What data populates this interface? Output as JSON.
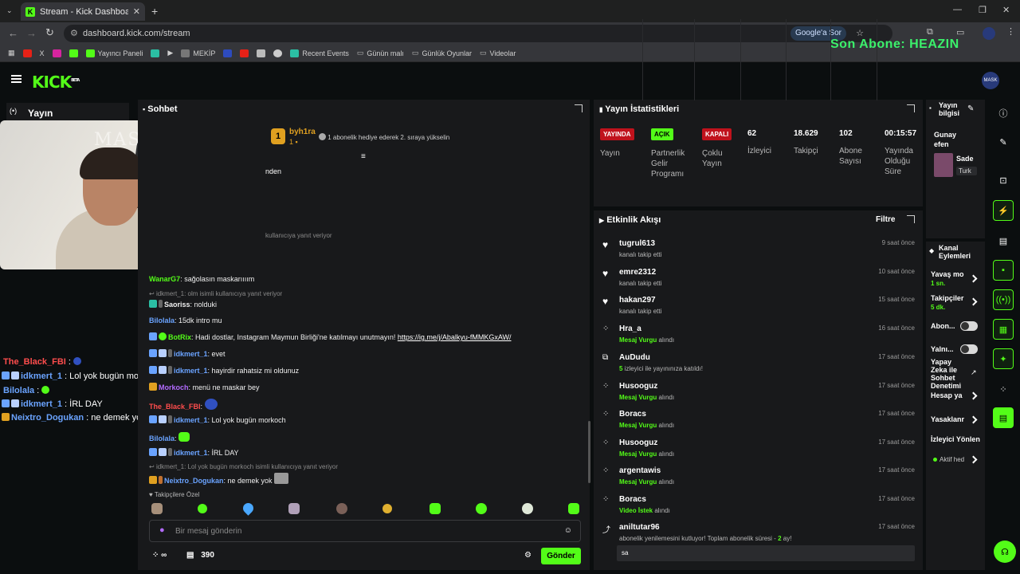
{
  "browser": {
    "tab_title": "Stream - Kick Dashboard",
    "url": "dashboard.kick.com/stream",
    "google_sor": "Google'a Sor",
    "bookmarks": [
      "Yayıncı Paneli",
      "MEKİP",
      "Recent Events",
      "Günün malı",
      "Günlük Oyunlar",
      "Videolar"
    ]
  },
  "stream_overlay": {
    "last_sub": "Son Abone: HEAZIN",
    "cam_watermark": "MASKAR"
  },
  "header": {
    "logo": "KICK",
    "logo_sup": "BETA"
  },
  "sidebar": {
    "stream_label": "Yayın"
  },
  "overlay_chat": [
    {
      "user": "The_Black_FBI",
      "text": " :",
      "color": "#ff4d4d"
    },
    {
      "user": "idkmert_1",
      "text": " : Lol yok bugün morkoch",
      "color": "#6aa3ff"
    },
    {
      "user": "Bilolala",
      "text": " :",
      "color": "#6aa3ff"
    },
    {
      "user": "idkmert_1",
      "text": " : İRL DAY",
      "color": "#6aa3ff"
    },
    {
      "user": "Neixtro_Dogukan",
      "text": " : ne demek yok",
      "color": "#6aa3ff"
    }
  ],
  "chat": {
    "title": "Sohbet",
    "pinned_user": "byh1ra",
    "pinned_rank": "1",
    "gift_promo": "1 abonelik hediye ederek 2. sıraya yükselin",
    "partial_line": "nden",
    "partial_reply": "kullanıcıya yanıt veriyor",
    "messages": [
      {
        "type": "msg",
        "user": "WanarG7",
        "color": "#53fc18",
        "text": ": sağolasın maskarıııım"
      },
      {
        "type": "reply",
        "text": "idkmert_1: olm isimli kullanıcıya yanıt veriyor"
      },
      {
        "type": "msg",
        "user": "Saoriss",
        "color": "#ffffff",
        "text": ": nolduki"
      },
      {
        "type": "msg",
        "user": "Bilolala",
        "color": "#6aa3ff",
        "text": ": 15dk intro mu"
      },
      {
        "type": "msg",
        "user": "BotRix",
        "color": "#53fc18",
        "text": ": Hadi dostlar, Instagram Maymun Birliği'ne katılmayı unutmayın! ",
        "link": "https://ig.me/j/Abalkyu-fMMKGxAW/"
      },
      {
        "type": "msg",
        "user": "idkmert_1",
        "color": "#6aa3ff",
        "text": ": evet"
      },
      {
        "type": "msg",
        "user": "idkmert_1",
        "color": "#6aa3ff",
        "text": ": hayirdir rahatsiz mi oldunuz"
      },
      {
        "type": "msg",
        "user": "Morkoch",
        "color": "#b36bff",
        "text": ": menü ne maskar bey"
      },
      {
        "type": "msg",
        "user": "The_Black_FBI",
        "color": "#ff4d4d",
        "text": ":"
      },
      {
        "type": "msg",
        "user": "idkmert_1",
        "color": "#6aa3ff",
        "text": ": Lol yok bugün morkoch"
      },
      {
        "type": "msg",
        "user": "Bilolala",
        "color": "#6aa3ff",
        "text": ":"
      },
      {
        "type": "msg",
        "user": "idkmert_1",
        "color": "#6aa3ff",
        "text": ": İRL DAY"
      },
      {
        "type": "reply",
        "text": "idkmert_1: Lol yok bugün morkoch isimli kullanıcıya yanıt veriyor"
      },
      {
        "type": "msg",
        "user": "Neixtro_Dogukan",
        "color": "#6aa3ff",
        "text": ": ne demek yok"
      }
    ],
    "follower_emotes_label": "Takipçilere Özel",
    "input_placeholder": "Bir mesaj gönderin",
    "points": "∞",
    "store_count": "390",
    "send_label": "Gönder"
  },
  "stats": {
    "title": "Yayın İstatistikleri",
    "items": [
      {
        "tag": "YAYINDA",
        "tag_bg": "#c0121c",
        "tag_fg": "#ffffff",
        "label": "Yayın"
      },
      {
        "tag": "AÇIK",
        "tag_bg": "#53fc18",
        "tag_fg": "#000000",
        "label": "Partnerlik Gelir Programı"
      },
      {
        "tag": "KAPALI",
        "tag_bg": "#c0121c",
        "tag_fg": "#ffffff",
        "label": "Çoklu Yayın"
      },
      {
        "value": "62",
        "label": "İzleyici"
      },
      {
        "value": "18.629",
        "label": "Takipçi"
      },
      {
        "value": "102",
        "label": "Abone Sayısı"
      },
      {
        "value": "00:15:57",
        "label": "Yayında Olduğu Süre"
      }
    ]
  },
  "activity": {
    "title": "Etkinlik Akışı",
    "filter_label": "Filtre",
    "events": [
      {
        "icon": "heart-icon",
        "name": "tugrul613",
        "sub": "kanalı takip etti",
        "time": "9 saat önce"
      },
      {
        "icon": "heart-icon",
        "name": "emre2312",
        "sub": "kanalı takip etti",
        "time": "10 saat önce"
      },
      {
        "icon": "heart-icon",
        "name": "hakan297",
        "sub": "kanalı takip etti",
        "time": "15 saat önce"
      },
      {
        "icon": "coins-icon",
        "name": "Hra_a",
        "sub_green": "Mesaj Vurgu",
        "sub": " alındı",
        "time": "16 saat önce"
      },
      {
        "icon": "raid-icon",
        "name": "AuDudu",
        "sub_green": "5",
        "sub": " izleyici ile yayınınıza katıldı!",
        "time": "17 saat önce"
      },
      {
        "icon": "coins-icon",
        "name": "Husooguz",
        "sub_green": "Mesaj Vurgu",
        "sub": " alındı",
        "time": "17 saat önce"
      },
      {
        "icon": "coins-icon",
        "name": "Boracs",
        "sub_green": "Mesaj Vurgu",
        "sub": " alındı",
        "time": "17 saat önce"
      },
      {
        "icon": "coins-icon",
        "name": "Husooguz",
        "sub_green": "Mesaj Vurgu",
        "sub": " alındı",
        "time": "17 saat önce"
      },
      {
        "icon": "coins-icon",
        "name": "argentawis",
        "sub_green": "Mesaj Vurgu",
        "sub": " alındı",
        "time": "17 saat önce"
      },
      {
        "icon": "coins-icon",
        "name": "Boracs",
        "sub_green": "Video İstek",
        "sub": " alındı",
        "time": "17 saat önce"
      }
    ],
    "resub": {
      "name": "aniltutar96",
      "time": "17 saat önce",
      "text_pre": "abonelik yenilemesini kutluyor! Toplam abonelik süresi - ",
      "months": "2",
      "text_post": " ay!",
      "message": "sa"
    }
  },
  "info": {
    "title": "Yayın bilgisi",
    "tooltip": "Düzenle",
    "stream_title": "Gunaydın efen",
    "category": "Sade",
    "lang_tag": "Turk"
  },
  "channel_actions": {
    "title": "Kanal Eylemleri",
    "slow_mode": "Yavaş mo",
    "slow_val": "1 sn.",
    "followers": "Takipçiler",
    "followers_val": "5 dk.",
    "subs": "Abon...",
    "unique": "Yalnı...",
    "ai": "Yapay Zeka ile Sohbet Denetimi",
    "account_age": "Hesap ya",
    "bans": "Yasaklanr",
    "viewer_mgmt": "İzleyici Yönlen",
    "active": "Aktif hed"
  }
}
